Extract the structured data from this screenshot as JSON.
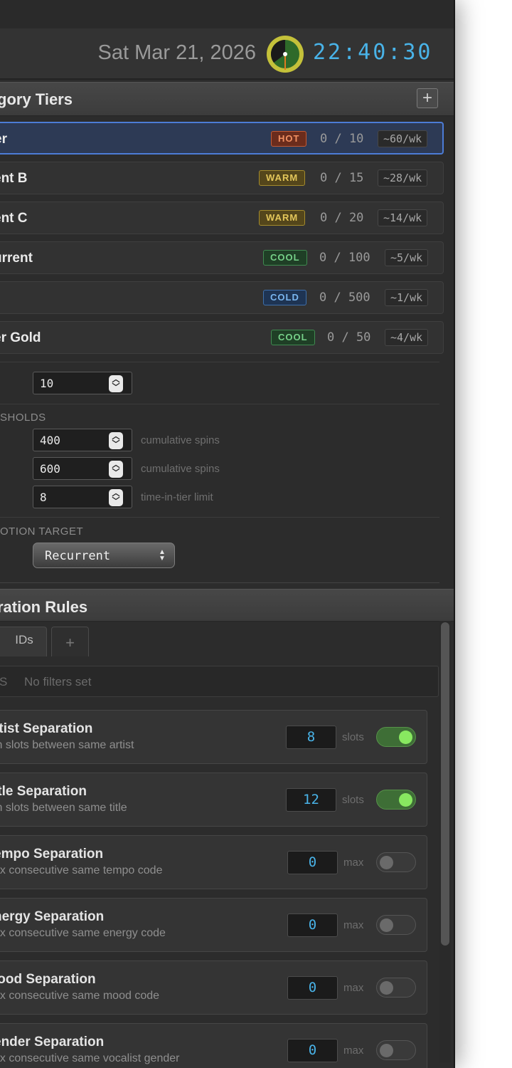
{
  "header": {
    "date": "Sat Mar 21, 2026",
    "time": "22:40:30"
  },
  "tiers_section": {
    "title": "gory Tiers",
    "add_label": "+",
    "tiers": [
      {
        "name": "er",
        "badge": "HOT",
        "count": "0 / 10",
        "rate": "~60/wk"
      },
      {
        "name": "ent B",
        "badge": "WARM",
        "count": "0 / 15",
        "rate": "~28/wk"
      },
      {
        "name": "ent C",
        "badge": "WARM",
        "count": "0 / 20",
        "rate": "~14/wk"
      },
      {
        "name": "urrent",
        "badge": "COOL",
        "count": "0 / 100",
        "rate": "~5/wk"
      },
      {
        "name": "",
        "badge": "COLD",
        "count": "0 / 500",
        "rate": "~1/wk"
      },
      {
        "name": "er Gold",
        "badge": "COOL",
        "count": "0 / 50",
        "rate": "~4/wk"
      }
    ]
  },
  "settings": {
    "first_value": "10",
    "thresholds_caption": "SHOLDS",
    "thresholds": [
      {
        "value": "400",
        "hint": "cumulative spins"
      },
      {
        "value": "600",
        "hint": "cumulative spins"
      },
      {
        "value": "8",
        "hint": "time-in-tier limit"
      }
    ],
    "promotion_caption": "OTION TARGET",
    "promotion_target": "Recurrent"
  },
  "separation_section": {
    "title": "ration Rules",
    "tabs": [
      {
        "label": ""
      },
      {
        "label": "IDs"
      },
      {
        "label": "+"
      }
    ],
    "filters_label": "S",
    "filters_value": "No filters set",
    "rules": [
      {
        "title": "rtist Separation",
        "desc": "in slots between same artist",
        "value": "8",
        "unit": "slots",
        "enabled": true
      },
      {
        "title": "itle Separation",
        "desc": "in slots between same title",
        "value": "12",
        "unit": "slots",
        "enabled": true
      },
      {
        "title": "empo Separation",
        "desc": "ax consecutive same tempo code",
        "value": "0",
        "unit": "max",
        "enabled": false
      },
      {
        "title": "nergy Separation",
        "desc": "ax consecutive same energy code",
        "value": "0",
        "unit": "max",
        "enabled": false
      },
      {
        "title": "lood Separation",
        "desc": "ax consecutive same mood code",
        "value": "0",
        "unit": "max",
        "enabled": false
      },
      {
        "title": "ender Separation",
        "desc": "ax consecutive same vocalist gender",
        "value": "0",
        "unit": "max",
        "enabled": false
      }
    ]
  },
  "colors": {
    "accent_blue": "#49b3e8",
    "hot": "#f19062",
    "warm": "#e3c65a",
    "cool": "#76d088",
    "cold": "#7ab6ef",
    "toggle_on": "#88e860"
  }
}
